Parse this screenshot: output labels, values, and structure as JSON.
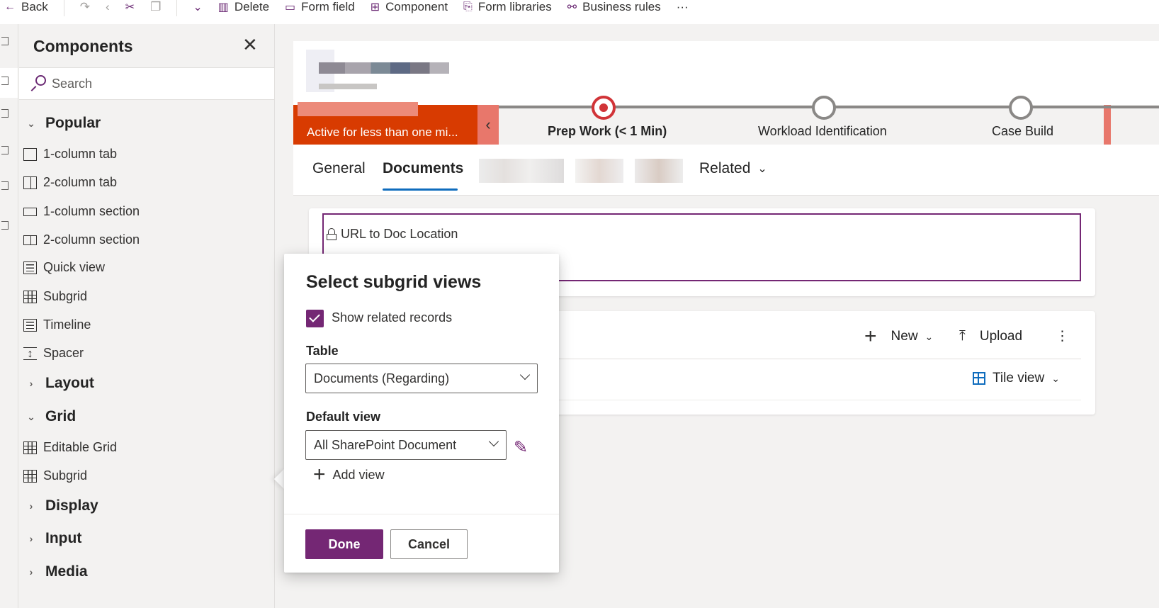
{
  "toolbar": {
    "back_label": "Back",
    "delete_label": "Delete",
    "form_field_label": "Form field",
    "component_label": "Component",
    "form_libraries_label": "Form libraries",
    "business_rules_label": "Business rules",
    "more_label": "···"
  },
  "components_panel": {
    "title": "Components",
    "close_glyph": "✕",
    "search_placeholder": "Search",
    "sections": {
      "popular": "Popular",
      "layout": "Layout",
      "grid": "Grid",
      "display": "Display",
      "input": "Input",
      "media": "Media"
    },
    "popular_items": [
      "1-column tab",
      "2-column tab",
      "1-column section",
      "2-column section",
      "Quick view",
      "Subgrid",
      "Timeline",
      "Spacer"
    ],
    "grid_items": [
      "Editable Grid",
      "Subgrid"
    ]
  },
  "bpf": {
    "status_text": "Active for less than one mi...",
    "stages": [
      "Prep Work  (< 1 Min)",
      "Workload Identification",
      "Case Build"
    ]
  },
  "tabs": {
    "general": "General",
    "documents": "Documents",
    "related": "Related"
  },
  "form": {
    "field_label": "URL to Doc Location",
    "new_label": "New",
    "upload_label": "Upload",
    "tile_view_label": "Tile view",
    "overflow_glyph": "⋮"
  },
  "dialog": {
    "title": "Select subgrid views",
    "show_related_label": "Show related records",
    "table_label": "Table",
    "table_value": "Documents (Regarding)",
    "default_view_label": "Default view",
    "default_view_value": "All SharePoint Document",
    "add_view_label": "Add view",
    "done_label": "Done",
    "cancel_label": "Cancel"
  },
  "colors": {
    "accent_purple": "#742774",
    "bpf_red": "#d83b01",
    "active_stage": "#d13438",
    "tab_underline": "#0f6cbd"
  }
}
